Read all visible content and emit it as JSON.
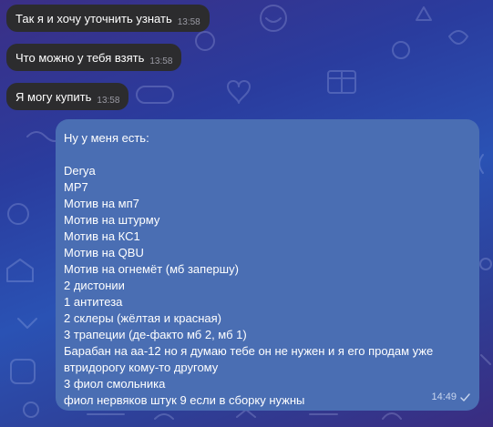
{
  "chat": {
    "incoming": [
      {
        "text": "Так я и хочу уточнить узнать",
        "time": "13:58"
      },
      {
        "text": "Что можно у тебя взять",
        "time": "13:58"
      },
      {
        "text": "Я могу купить",
        "time": "13:58"
      }
    ],
    "outgoing": {
      "lines": [
        "Ну у меня есть:",
        "",
        "Derya",
        "MP7",
        "Мотив на мп7",
        "Мотив на штурму",
        "Мотив на КС1",
        "Мотив на QBU",
        "Мотив на огнемёт (мб запершу)",
        "2 дистонии",
        "1 антитеза",
        "2 склеры (жёлтая и красная)",
        "3 трапеции (де-факто мб 2, мб 1)",
        "Барабан на аа-12 но я думаю тебе он не нужен и я его продам уже",
        "втридорогу кому-то другому",
        "3 фиол смольника",
        "фиол нервяков штук 9 если в сборку нужны"
      ],
      "time": "14:49",
      "status_icon": "sent-check-icon"
    }
  },
  "colors": {
    "incoming_bubble": "#2c2c2e",
    "outgoing_bubble": "#4a6eb3",
    "background_accent": "#2a52b4"
  }
}
